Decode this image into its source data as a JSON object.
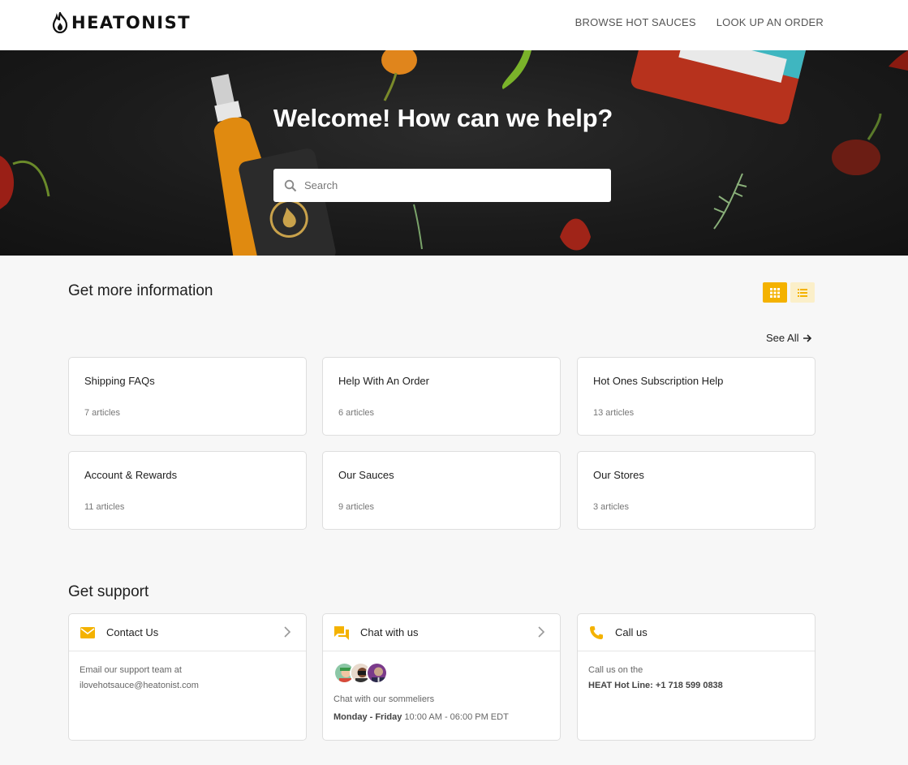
{
  "header": {
    "logo_text": "HEATONIST",
    "nav": [
      "BROWSE HOT SAUCES",
      "LOOK UP AN ORDER"
    ]
  },
  "hero": {
    "title": "Welcome! How can we help?",
    "search_placeholder": "Search"
  },
  "info": {
    "title": "Get more information",
    "see_all": "See All",
    "categories": [
      {
        "title": "Shipping FAQs",
        "count": "7 articles"
      },
      {
        "title": "Help With An Order",
        "count": "6 articles"
      },
      {
        "title": "Hot Ones Subscription Help",
        "count": "13 articles"
      },
      {
        "title": "Account & Rewards",
        "count": "11 articles"
      },
      {
        "title": "Our Sauces",
        "count": "9 articles"
      },
      {
        "title": "Our Stores",
        "count": "3 articles"
      }
    ]
  },
  "support": {
    "title": "Get support",
    "contact": {
      "title": "Contact Us",
      "line1": "Email our support team at",
      "line2": "ilovehotsauce@heatonist.com"
    },
    "chat": {
      "title": "Chat with us",
      "line1": "Chat with our sommeliers",
      "days": "Monday - Friday",
      "hours": "10:00 AM - 06:00 PM EDT"
    },
    "call": {
      "title": "Call us",
      "line1": "Call us on the",
      "label": "HEAT Hot Line:",
      "number": "+1 718 599 0838"
    }
  },
  "colors": {
    "accent": "#f4b200",
    "accent_light": "#fbefc9",
    "hero_bg": "#1b1b1b"
  },
  "icons": [
    "flame-logo-icon",
    "search-icon",
    "grid-view-icon",
    "list-view-icon",
    "arrow-right-icon",
    "mail-icon",
    "chat-icon",
    "phone-icon",
    "chevron-right-icon"
  ]
}
